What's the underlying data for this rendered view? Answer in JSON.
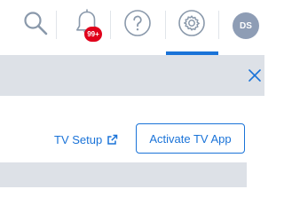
{
  "header": {
    "search_icon": "search-icon",
    "bell_icon": "bell-icon",
    "notification_badge": "99+",
    "help_icon": "help-icon",
    "settings_icon": "gear-icon",
    "avatar_initials": "DS",
    "active_item": "settings"
  },
  "banner": {
    "close_icon": "close-icon"
  },
  "tv": {
    "setup_link": "TV Setup",
    "setup_link_icon": "external-link-icon",
    "activate_button": "Activate TV App"
  },
  "colors": {
    "accent": "#1a73d8",
    "badge": "#e0001b",
    "avatar_bg": "#8e9db5",
    "band_bg": "#dde1e7",
    "icon_gray": "#8a99ab"
  }
}
